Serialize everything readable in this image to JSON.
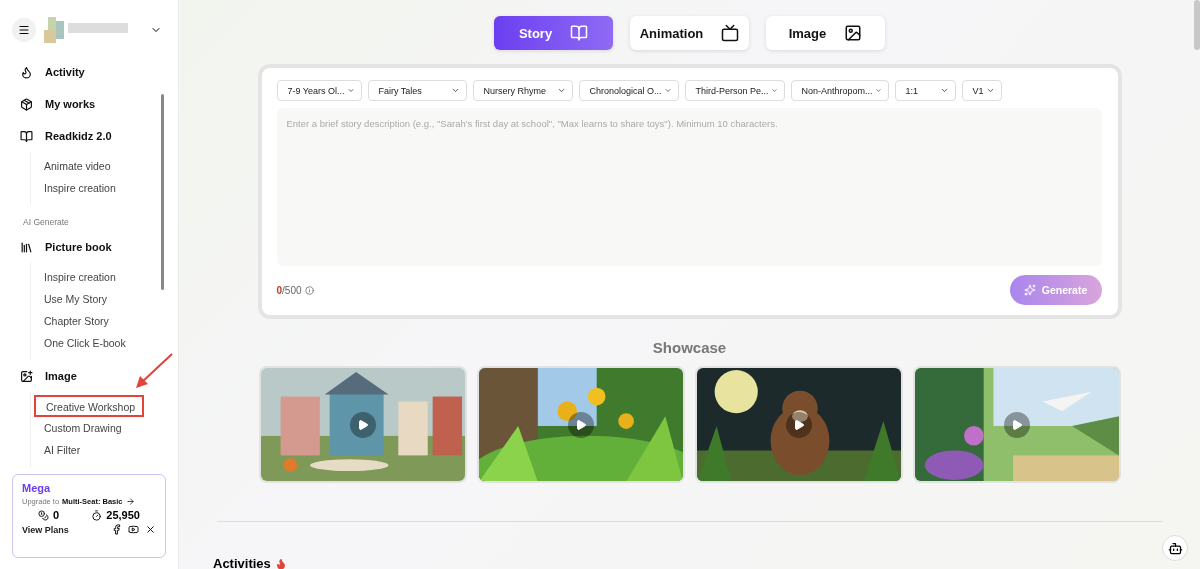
{
  "sidebar": {
    "nav": [
      {
        "label": "Activity"
      },
      {
        "label": "My works"
      },
      {
        "label": "Readkidz 2.0",
        "children": [
          {
            "label": "Animate video",
            "highlighted": false
          },
          {
            "label": "Inspire creation",
            "highlighted": false
          }
        ]
      },
      {
        "kind": "heading",
        "label": "AI Generate"
      },
      {
        "label": "Picture book",
        "children": [
          {
            "label": "Inspire creation",
            "highlighted": false
          },
          {
            "label": "Use My Story",
            "highlighted": false
          },
          {
            "label": "Chapter Story",
            "highlighted": false
          },
          {
            "label": "One Click E-book",
            "highlighted": false
          }
        ]
      },
      {
        "label": "Image",
        "children": [
          {
            "label": "Creative Workshop",
            "highlighted": true
          },
          {
            "label": "Custom Drawing",
            "highlighted": false
          },
          {
            "label": "AI Filter",
            "highlighted": false
          }
        ]
      }
    ],
    "plan": {
      "name": "Mega",
      "upgrade_prefix": "Upgrade to",
      "upgrade_target": "Multi-Seat: Basic",
      "coins": "0",
      "credits": "25,950",
      "link": "View Plans"
    }
  },
  "mode_tabs": [
    {
      "label": "Story",
      "selected": true
    },
    {
      "label": "Animation",
      "selected": false
    },
    {
      "label": "Image",
      "selected": false
    }
  ],
  "options": [
    "7-9 Years Ol...",
    "Fairy Tales",
    "Nursery Rhyme",
    "Chronological O...",
    "Third-Person Pe...",
    "Non-Anthropom...",
    "1:1",
    "V1"
  ],
  "story_field": {
    "placeholder": "Enter a brief story description (e.g., \"Sarah's first day at school\", \"Max learns to share toys\"). Minimum 10 characters."
  },
  "counter": {
    "current": "0",
    "max": "/500"
  },
  "generate_button": "Generate",
  "showcase": {
    "title": "Showcase",
    "videos": [
      {
        "kind": "houses"
      },
      {
        "kind": "sunflowers"
      },
      {
        "kind": "bear"
      },
      {
        "kind": "garden"
      }
    ]
  },
  "activities_title": "Activities"
}
